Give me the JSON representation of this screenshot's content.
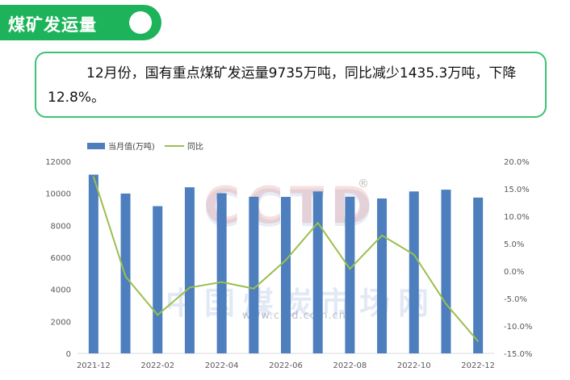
{
  "header": {
    "title": "煤矿发运量"
  },
  "summary": {
    "text": "12月份，国有重点煤矿发运量9735万吨，同比减少1435.3万吨，下降12.8%。"
  },
  "watermark": {
    "logo": "CCTD",
    "registered": "®",
    "chinese": "中国煤炭市场网",
    "url": "www.cctd.com.cn"
  },
  "colors": {
    "bar": "#4d7ebd",
    "line": "#9bbf4f",
    "accent": "#1cb35a"
  },
  "chart_data": {
    "type": "bar",
    "categories": [
      "2021-12",
      "2022-01",
      "2022-02",
      "2022-03",
      "2022-04",
      "2022-05",
      "2022-06",
      "2022-07",
      "2022-08",
      "2022-09",
      "2022-10",
      "2022-11",
      "2022-12"
    ],
    "x_tick_labels": [
      "2021-12",
      "2022-02",
      "2022-04",
      "2022-06",
      "2022-08",
      "2022-10",
      "2022-12"
    ],
    "series": [
      {
        "name": "当月值(万吨)",
        "type": "bar",
        "axis": "left",
        "values": [
          11170,
          9990,
          9200,
          10380,
          10010,
          9790,
          9780,
          10120,
          9790,
          9680,
          10120,
          10230,
          9735
        ]
      },
      {
        "name": "同比",
        "type": "line",
        "axis": "right",
        "values": [
          17.2,
          -1.0,
          -8.0,
          -3.0,
          -2.0,
          -3.2,
          2.0,
          8.8,
          0.4,
          6.5,
          3.0,
          -6.0,
          -12.8
        ]
      }
    ],
    "y_left": {
      "min": 0,
      "max": 12000,
      "ticks": [
        "0",
        "2000",
        "4000",
        "6000",
        "8000",
        "10000",
        "12000"
      ]
    },
    "y_right": {
      "min": -15,
      "max": 20,
      "ticks": [
        "-15.0%",
        "-10.0%",
        "-5.0%",
        "0.0%",
        "5.0%",
        "10.0%",
        "15.0%",
        "20.0%"
      ]
    },
    "legend": {
      "position": "top-left"
    },
    "grid": false
  }
}
